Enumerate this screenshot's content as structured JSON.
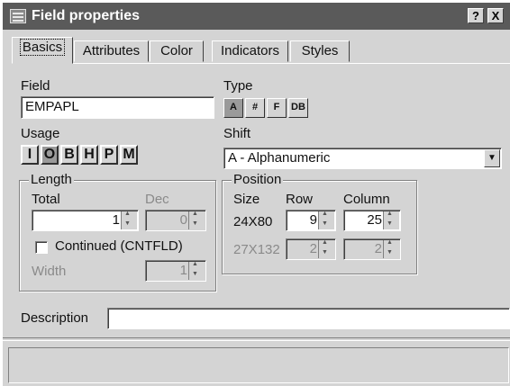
{
  "window": {
    "title": "Field properties",
    "help_label": "?",
    "close_label": "X"
  },
  "tabs": [
    {
      "label": "Basics"
    },
    {
      "label": "Attributes"
    },
    {
      "label": "Color"
    },
    {
      "label": "Indicators"
    },
    {
      "label": "Styles"
    }
  ],
  "field": {
    "label": "Field",
    "value": "EMPAPL"
  },
  "type": {
    "label": "Type",
    "buttons": [
      "A",
      "#",
      "F",
      "DB"
    ]
  },
  "usage": {
    "label": "Usage",
    "buttons": [
      "I",
      "O",
      "B",
      "H",
      "P",
      "M"
    ]
  },
  "shift": {
    "label": "Shift",
    "selected": "A - Alphanumeric"
  },
  "length": {
    "group_label": "Length",
    "total_label": "Total",
    "total_value": "1",
    "dec_label": "Dec",
    "dec_value": "0",
    "continued_label": "Continued (CNTFLD)",
    "width_label": "Width",
    "width_value": "1"
  },
  "position": {
    "group_label": "Position",
    "size_label": "Size",
    "row_label": "Row",
    "column_label": "Column",
    "row1_size": "24X80",
    "row1_row": "9",
    "row1_col": "25",
    "row2_size": "27X132",
    "row2_row": "2",
    "row2_col": "2"
  },
  "description": {
    "label": "Description",
    "value": ""
  }
}
